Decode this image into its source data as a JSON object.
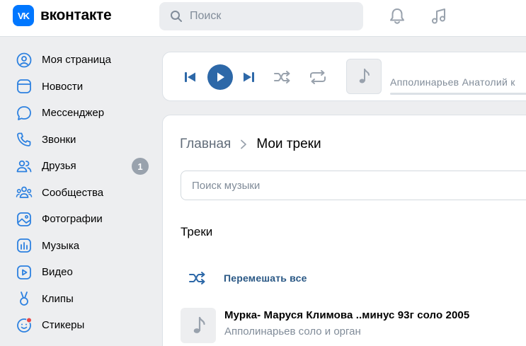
{
  "header": {
    "logo_mark": "VK",
    "logo_text": "вконтакте",
    "search_placeholder": "Поиск",
    "icons": [
      "bell-icon",
      "music-note-icon"
    ]
  },
  "sidebar": {
    "items": [
      {
        "label": "Моя страница",
        "icon": "user-circle-icon"
      },
      {
        "label": "Новости",
        "icon": "news-icon"
      },
      {
        "label": "Мессенджер",
        "icon": "message-icon"
      },
      {
        "label": "Звонки",
        "icon": "phone-icon"
      },
      {
        "label": "Друзья",
        "icon": "friends-icon",
        "badge": "1"
      },
      {
        "label": "Сообщества",
        "icon": "communities-icon"
      },
      {
        "label": "Фотографии",
        "icon": "photo-icon"
      },
      {
        "label": "Музыка",
        "icon": "music-icon"
      },
      {
        "label": "Видео",
        "icon": "video-icon"
      },
      {
        "label": "Клипы",
        "icon": "clips-icon"
      },
      {
        "label": "Стикеры",
        "icon": "sticker-icon"
      }
    ]
  },
  "player": {
    "track_title": "Апполинарьев Анатолий к",
    "controls": [
      "previous-icon",
      "play-icon",
      "next-icon",
      "shuffle-icon",
      "repeat-icon"
    ]
  },
  "content": {
    "breadcrumb_home": "Главная",
    "breadcrumb_current": "Мои треки",
    "search_placeholder": "Поиск музыки",
    "tracks_title": "Треки",
    "shuffle_all": "Перемешать все",
    "tracks": [
      {
        "title": "Мурка- Маруся Климова ..минус 93г соло 2005",
        "artist": "Апполинарьев соло и орган"
      }
    ]
  },
  "colors": {
    "accent": "#0077ff",
    "link": "#2a5885",
    "play_button": "#2d68a8",
    "icon": "#2d81e0",
    "background": "#edeef0"
  }
}
